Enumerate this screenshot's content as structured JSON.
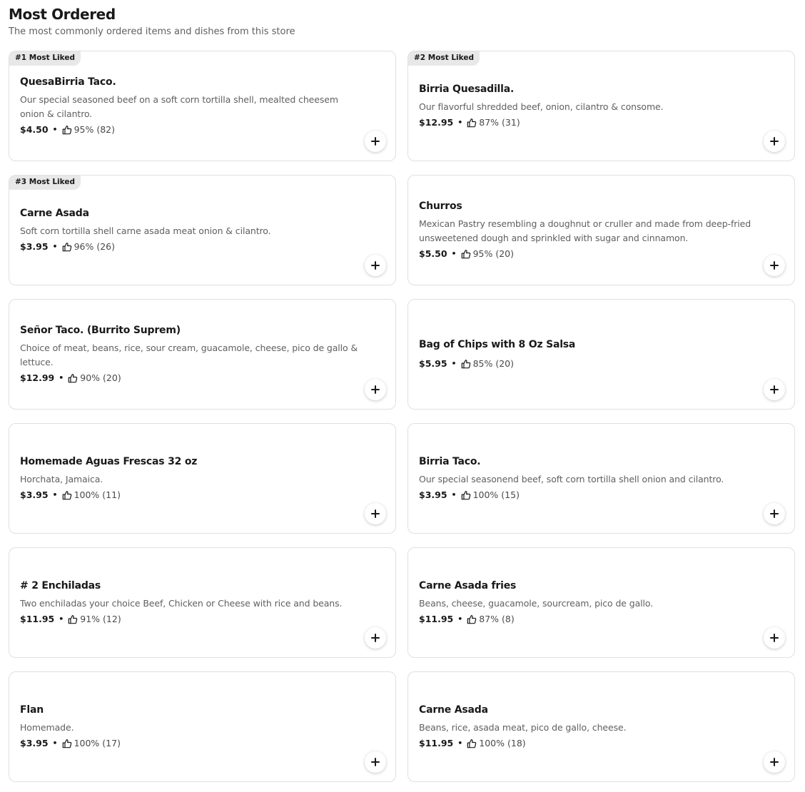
{
  "section": {
    "title": "Most Ordered",
    "subtitle": "The most commonly ordered items and dishes from this store"
  },
  "items": [
    {
      "badge": "#1 Most Liked",
      "name": "QuesaBirria Taco.",
      "desc": "Our special seasoned beef on a soft corn tortilla shell, mealted cheesem onion & cilantro.",
      "price": "$4.50",
      "rating": "95% (82)"
    },
    {
      "badge": "#2 Most Liked",
      "name": "Birria Quesadilla.",
      "desc": "Our flavorful shredded beef, onion, cilantro & consome.",
      "price": "$12.95",
      "rating": "87% (31)"
    },
    {
      "badge": "#3 Most Liked",
      "name": "Carne Asada",
      "desc": "Soft corn tortilla shell carne asada meat onion & cilantro.",
      "price": "$3.95",
      "rating": "96% (26)"
    },
    {
      "badge": "",
      "name": "Churros",
      "desc": "Mexican Pastry resembling a doughnut or cruller and made from deep-fried unsweetened dough and sprinkled with sugar and cinnamon.",
      "price": "$5.50",
      "rating": "95% (20)"
    },
    {
      "badge": "",
      "name": "Señor Taco. (Burrito Suprem)",
      "desc": "Choice of meat, beans, rice, sour cream, guacamole, cheese, pico de gallo & lettuce.",
      "price": "$12.99",
      "rating": "90% (20)"
    },
    {
      "badge": "",
      "name": "Bag of Chips with 8 Oz Salsa",
      "desc": "",
      "price": "$5.95",
      "rating": "85% (20)"
    },
    {
      "badge": "",
      "name": "Homemade Aguas Frescas 32 oz",
      "desc": "Horchata, Jamaica.",
      "price": "$3.95",
      "rating": "100% (11)"
    },
    {
      "badge": "",
      "name": "Birria Taco.",
      "desc": "Our special seasonend beef, soft corn tortilla shell onion and cilantro.",
      "price": "$3.95",
      "rating": "100% (15)"
    },
    {
      "badge": "",
      "name": "# 2 Enchiladas",
      "desc": "Two enchiladas your choice Beef, Chicken or Cheese with rice and beans.",
      "price": "$11.95",
      "rating": "91% (12)"
    },
    {
      "badge": "",
      "name": "Carne Asada fries",
      "desc": "Beans, cheese, guacamole, sourcream, pico de gallo.",
      "price": "$11.95",
      "rating": "87% (8)"
    },
    {
      "badge": "",
      "name": "Flan",
      "desc": "Homemade.",
      "price": "$3.95",
      "rating": "100% (17)"
    },
    {
      "badge": "",
      "name": "Carne Asada",
      "desc": "Beans, rice, asada meat, pico de gallo, cheese.",
      "price": "$11.95",
      "rating": "100% (18)"
    }
  ],
  "icons": {
    "rating": "thumbs-up-icon",
    "add": "plus-icon"
  },
  "separator": "•"
}
